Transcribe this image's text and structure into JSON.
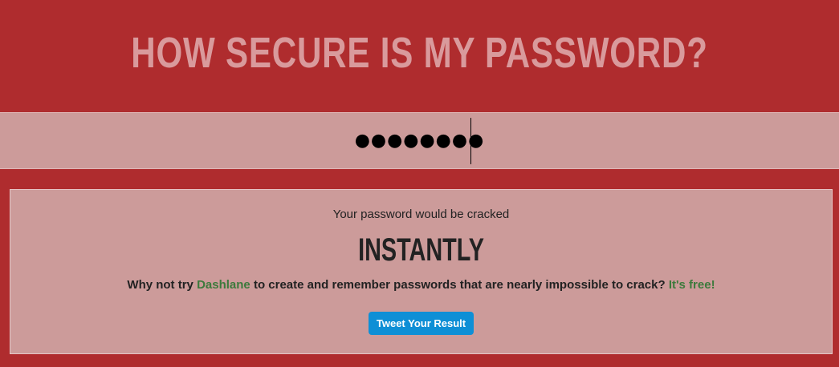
{
  "header": {
    "title": "HOW SECURE IS MY PASSWORD?"
  },
  "password_input": {
    "value": "●●●●●●●●"
  },
  "result": {
    "intro": "Your password would be cracked",
    "verdict": "INSTANTLY",
    "promo": {
      "prefix": "Why not try ",
      "link_label": "Dashlane",
      "middle": " to create and remember passwords that are nearly impossible to crack? ",
      "free_label": "It's free!"
    },
    "tweet_button_label": "Tweet Your Result"
  },
  "colors": {
    "background": "#af2c2e",
    "panel": "#cc9b9a",
    "link_green": "#3c7a3c",
    "tweet_blue": "#0e8fd6"
  }
}
